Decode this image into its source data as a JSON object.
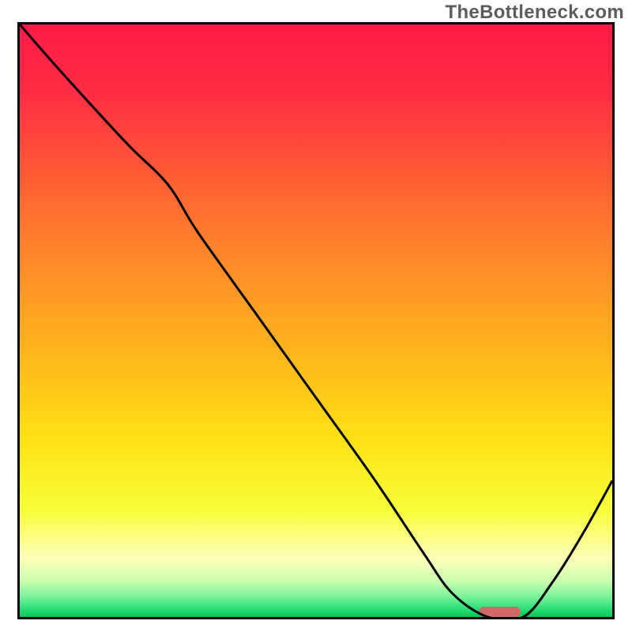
{
  "watermark": "TheBottleneck.com",
  "chart_data": {
    "type": "line",
    "title": "",
    "xlabel": "",
    "ylabel": "",
    "xlim": [
      0,
      100
    ],
    "ylim": [
      0,
      100
    ],
    "grid": false,
    "legend": false,
    "series": [
      {
        "name": "curve",
        "x": [
          0,
          7,
          18,
          25,
          30,
          40,
          50,
          60,
          68,
          73,
          79,
          85,
          90,
          95,
          100
        ],
        "values": [
          100,
          92,
          80,
          73,
          65,
          51,
          37,
          23,
          11,
          4,
          0,
          0,
          6,
          14,
          23
        ]
      }
    ],
    "marker": {
      "name": "highlight-bar",
      "x_center": 81,
      "y": 0,
      "width_pct": 7,
      "color": "#cf6a6a"
    },
    "gradient_stops": [
      {
        "offset": 0.0,
        "color": "#ff1a48"
      },
      {
        "offset": 0.12,
        "color": "#ff2e43"
      },
      {
        "offset": 0.25,
        "color": "#ff5a36"
      },
      {
        "offset": 0.4,
        "color": "#ff8a2a"
      },
      {
        "offset": 0.55,
        "color": "#ffb41e"
      },
      {
        "offset": 0.7,
        "color": "#ffe114"
      },
      {
        "offset": 0.82,
        "color": "#f6ff3a"
      },
      {
        "offset": 0.9,
        "color": "#ffffb8"
      },
      {
        "offset": 0.94,
        "color": "#c8ffb0"
      },
      {
        "offset": 0.965,
        "color": "#7df29a"
      },
      {
        "offset": 0.985,
        "color": "#2ee07a"
      },
      {
        "offset": 1.0,
        "color": "#00c853"
      }
    ],
    "frame_color": "#000000",
    "curve_color": "#000000"
  }
}
